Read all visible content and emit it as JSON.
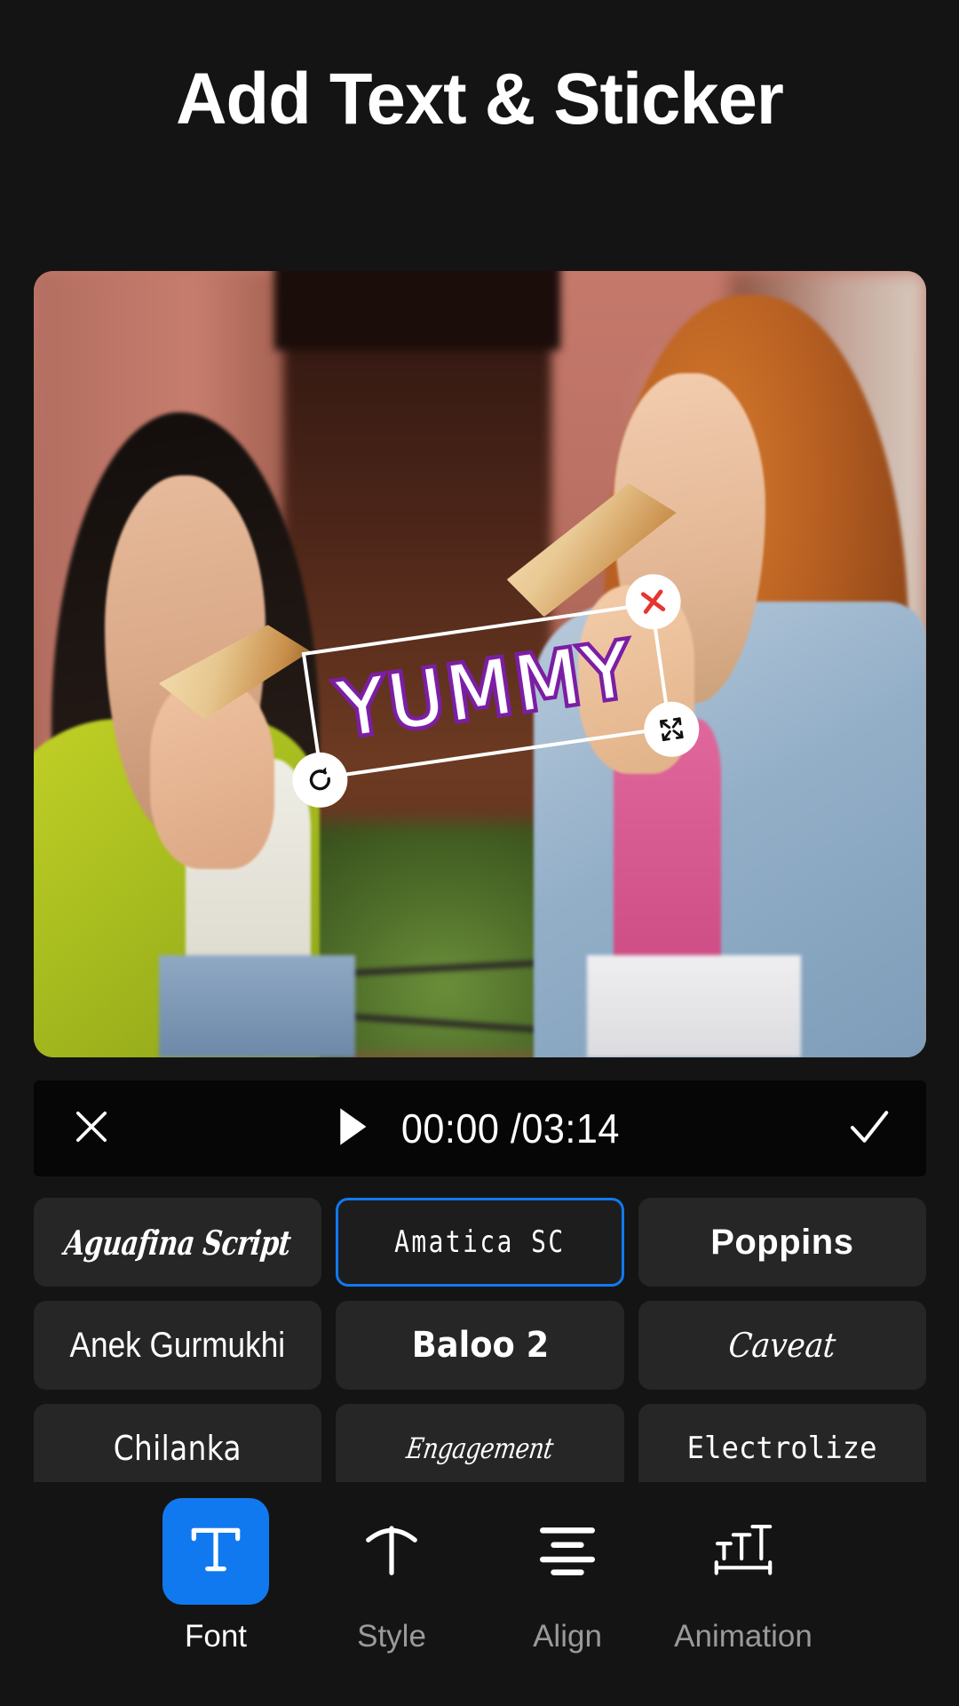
{
  "header": {
    "title": "Add Text & Sticker"
  },
  "preview": {
    "alt": "Two women eating pizza slices outdoors",
    "sticker": {
      "text": "YUMMY",
      "fill_color": "#ffffff",
      "stroke_color": "#7a1fa2",
      "rotation_deg": -8.2,
      "handles": {
        "delete": "close-x-icon",
        "resize": "resize-arrows-icon",
        "rotate": "rotate-icon"
      }
    }
  },
  "playbar": {
    "close_icon": "close-icon",
    "play_icon": "play-icon",
    "current_time": "00:00",
    "separator": "/",
    "total_time": "03:14",
    "time_display": "00:00 /03:14",
    "confirm_icon": "check-icon"
  },
  "fonts": {
    "selected": "Amatica SC",
    "accent_color": "#1179f0",
    "items": [
      {
        "label": "Aguafina Script",
        "style": "f-script",
        "selected": false
      },
      {
        "label": "Amatica SC",
        "style": "f-amatica",
        "selected": true
      },
      {
        "label": "Poppins",
        "style": "f-poppins",
        "selected": false
      },
      {
        "label": "Anek Gurmukhi",
        "style": "f-anek",
        "selected": false
      },
      {
        "label": "Baloo 2",
        "style": "f-baloo",
        "selected": false
      },
      {
        "label": "Caveat",
        "style": "f-caveat",
        "selected": false
      },
      {
        "label": "Chilanka",
        "style": "f-chilanka",
        "selected": false
      },
      {
        "label": "Engagement",
        "style": "f-engage",
        "selected": false
      },
      {
        "label": "Electrolize",
        "style": "f-electro",
        "selected": false
      }
    ]
  },
  "toolbar": {
    "items": [
      {
        "label": "Font",
        "icon": "text-t-icon",
        "active": true
      },
      {
        "label": "Style",
        "icon": "text-arch-icon",
        "active": false
      },
      {
        "label": "Align",
        "icon": "align-center-icon",
        "active": false
      },
      {
        "label": "Animation",
        "icon": "text-size-icon",
        "active": false
      }
    ]
  },
  "colors": {
    "background": "#141414",
    "chip_background": "#262626",
    "accent": "#1179f0",
    "playbar_background": "#060606"
  }
}
